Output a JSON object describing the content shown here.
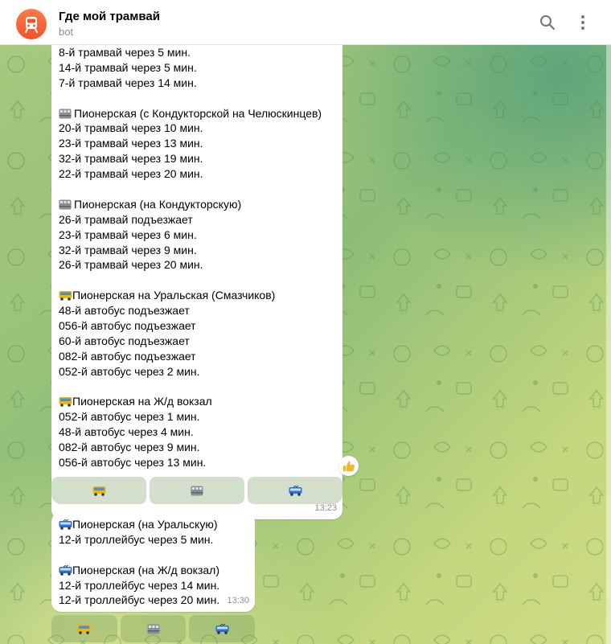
{
  "header": {
    "title": "Где мой трамвай",
    "subtitle": "bot",
    "avatar_icon": "tram-icon",
    "avatar_color": "#f0522a"
  },
  "message1": {
    "lines_top": [
      "8-й трамвай через 5 мин.",
      "14-й трамвай через 5 мин.",
      "7-й трамвай через 14 мин."
    ],
    "stop_a": {
      "icon": "tram-stop-icon",
      "title": "Пионерская (с Кондукторской на Челюскинцев)",
      "lines": [
        "20-й трамвай через 10 мин.",
        "23-й трамвай через 13 мин.",
        "32-й трамвай через 19 мин.",
        "22-й трамвай через 20 мин."
      ]
    },
    "stop_b": {
      "icon": "tram-stop-icon",
      "title": "Пионерская (на Кондукторскую)",
      "lines": [
        "26-й трамвай подъезжает",
        "23-й трамвай через 6 мин.",
        "32-й трамвай через 9 мин.",
        "26-й трамвай через 20 мин."
      ]
    },
    "stop_c": {
      "icon": "bus-icon",
      "title": "Пионерская на Уральская (Смазчиков)",
      "lines": [
        "48-й автобус подъезжает",
        "056-й автобус подъезжает",
        "60-й автобус подъезжает",
        "082-й автобус подъезжает",
        "052-й автобус через 2 мин."
      ]
    },
    "stop_d": {
      "icon": "bus-icon",
      "title": "Пионерская на Ж/д вокзал",
      "lines": [
        "052-й автобус через 1 мин.",
        "48-й автобус через 4 мин.",
        "082-й автобус через 9 мин.",
        "056-й автобус через 13 мин."
      ]
    },
    "time": "13:23",
    "reaction": "thumbs-up-icon"
  },
  "keyboard1": [
    "bus-icon",
    "tram-icon",
    "trolleybus-icon"
  ],
  "message2": {
    "stop_a": {
      "icon": "trolleybus-icon",
      "title": "Пионерская (на Уральскую)",
      "lines": [
        "12-й троллейбус через 5 мин."
      ]
    },
    "stop_b": {
      "icon": "trolleybus-icon",
      "title": "Пионерская (на Ж/д вокзал)",
      "lines": [
        "12-й троллейбус через 14 мин.",
        "12-й троллейбус через 20 мин."
      ]
    },
    "time": "13:30"
  },
  "keyboard2": [
    "bus-icon",
    "tram-icon",
    "trolleybus-icon"
  ],
  "colors": {
    "bubble": "#ffffff",
    "wallpaper_green": "#8dbd77",
    "wallpaper_yellow": "#cfdc84",
    "accent": "#f0522a"
  }
}
